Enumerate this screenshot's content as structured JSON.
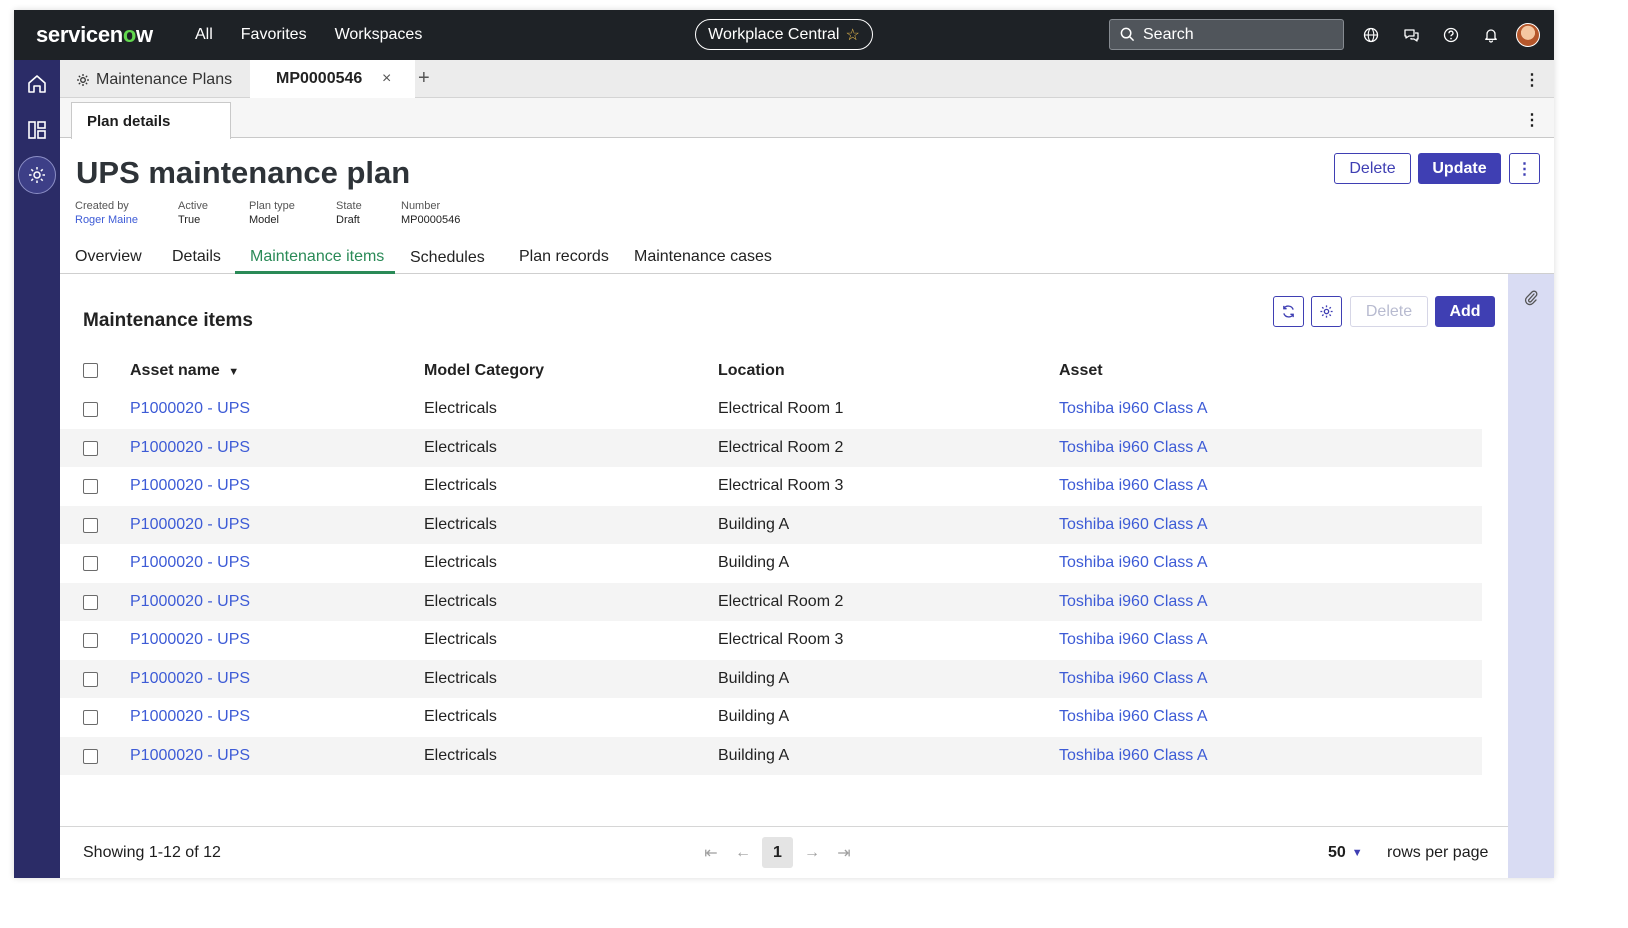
{
  "topbar": {
    "logo_pre": "servicen",
    "logo_o": "o",
    "logo_post": "w",
    "nav": [
      "All",
      "Favorites",
      "Workspaces"
    ],
    "workspace_pill": "Workplace Central",
    "search_placeholder": "Search",
    "icons": [
      "globe-icon",
      "chat-icon",
      "help-icon",
      "bell-icon"
    ]
  },
  "tabs": {
    "first": "Maintenance Plans",
    "active": "MP0000546",
    "close": "×",
    "add": "+"
  },
  "subtab": {
    "label": "Plan details"
  },
  "record": {
    "title": "UPS maintenance plan",
    "meta": [
      {
        "label": "Created by",
        "value": "Roger Maine",
        "link": true
      },
      {
        "label": "Active",
        "value": "True"
      },
      {
        "label": "Plan type",
        "value": "Model"
      },
      {
        "label": "State",
        "value": "Draft"
      },
      {
        "label": "Number",
        "value": "MP0000546"
      }
    ],
    "delete_label": "Delete",
    "update_label": "Update"
  },
  "view_tabs": [
    "Overview",
    "Details",
    "Maintenance items",
    "Schedules",
    "Plan records",
    "Maintenance cases"
  ],
  "active_view_tab": "Maintenance items",
  "list": {
    "title": "Maintenance items",
    "delete_label": "Delete",
    "add_label": "Add",
    "columns": [
      "Asset name",
      "Model Category",
      "Location",
      "Asset"
    ],
    "rows": [
      [
        "P1000020 - UPS",
        "Electricals",
        "Electrical Room 1",
        "Toshiba i960 Class A"
      ],
      [
        "P1000020 - UPS",
        "Electricals",
        "Electrical Room 2",
        "Toshiba i960 Class A"
      ],
      [
        "P1000020 - UPS",
        "Electricals",
        "Electrical Room 3",
        "Toshiba i960 Class A"
      ],
      [
        "P1000020 - UPS",
        "Electricals",
        "Building A",
        "Toshiba i960 Class A"
      ],
      [
        "P1000020 - UPS",
        "Electricals",
        "Building A",
        "Toshiba i960 Class A"
      ],
      [
        "P1000020 - UPS",
        "Electricals",
        "Electrical Room 2",
        "Toshiba i960 Class A"
      ],
      [
        "P1000020 - UPS",
        "Electricals",
        "Electrical Room 3",
        "Toshiba i960 Class A"
      ],
      [
        "P1000020 - UPS",
        "Electricals",
        "Building A",
        "Toshiba i960 Class A"
      ],
      [
        "P1000020 - UPS",
        "Electricals",
        "Building A",
        "Toshiba i960 Class A"
      ],
      [
        "P1000020 - UPS",
        "Electricals",
        "Building A",
        "Toshiba i960 Class A"
      ]
    ]
  },
  "footer": {
    "showing": "Showing 1-12 of 12",
    "current_page": "1",
    "rows_per_page": "50",
    "rows_per_page_label": "rows per page"
  },
  "colors": {
    "topbar": "#1e2226",
    "rail": "#2b2c67",
    "primary": "#3f3fb3",
    "link": "#3d5bd6",
    "active_tab": "#2a8a57",
    "logo_accent": "#62d84e"
  }
}
